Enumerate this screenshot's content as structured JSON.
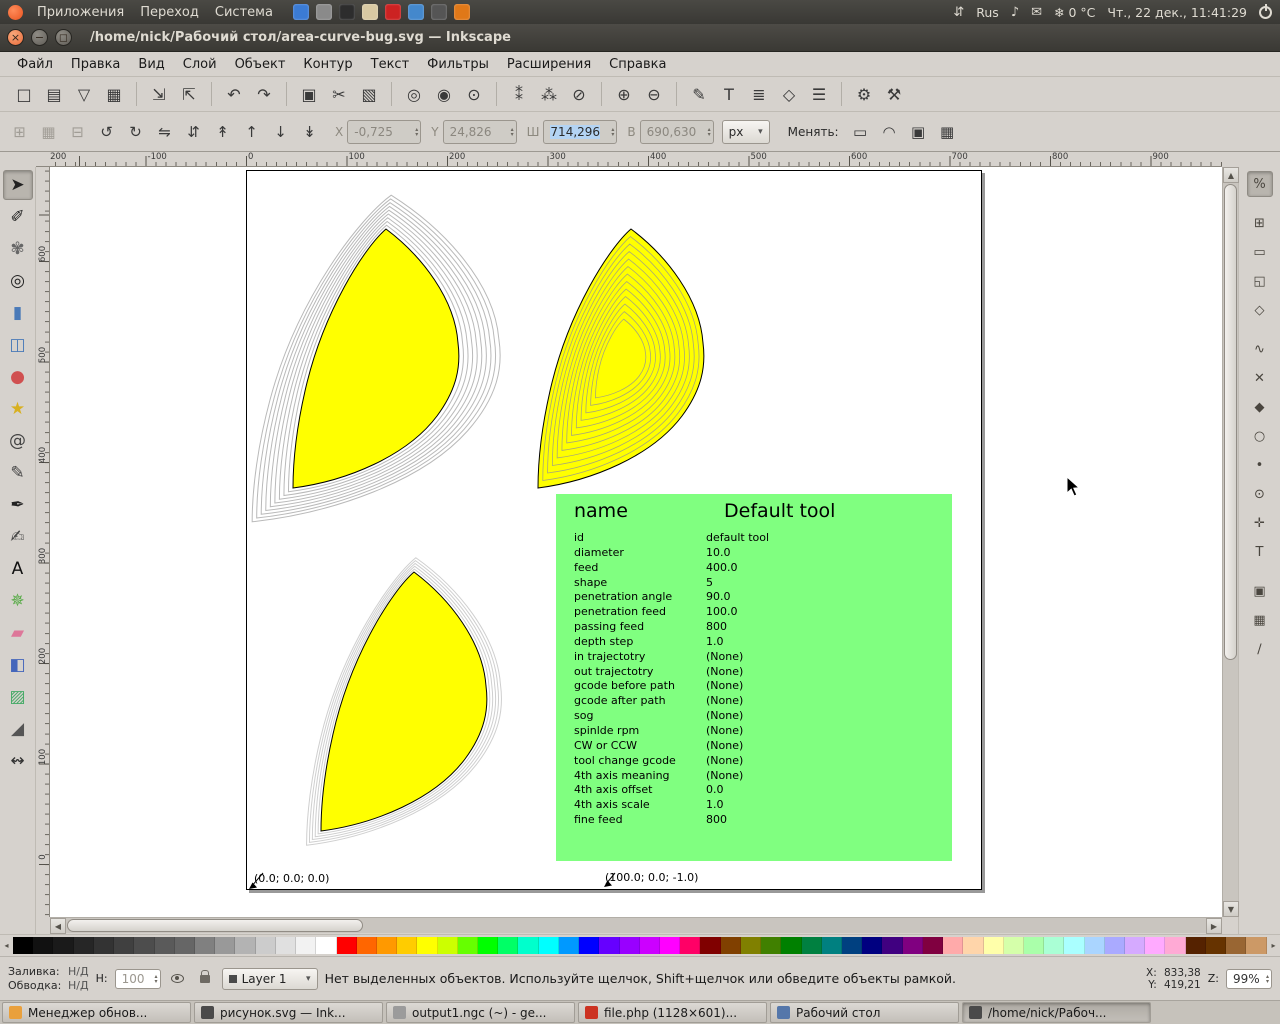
{
  "colors": {
    "panel_bg": "#3b3a36",
    "panel_fg": "#dfdbd2",
    "chrome_bg": "#d6d2cd",
    "chrome_border": "#a9a49d",
    "canvas_bg": "#ffffff",
    "page_border": "#000000",
    "shape_fill": "#ffff00",
    "shape_stroke": "#000000",
    "outer_contour": "#b9b9b9",
    "inner_contour": "#a8a878",
    "infobox_bg": "#80ff80",
    "close_btn": "#e96b3a",
    "selection_bg": "#b3d3f3",
    "taskbar_bg": "#c6c2bb"
  },
  "desktop": {
    "panel_menus": [
      "Приложения",
      "Переход",
      "Система"
    ],
    "launcher_icons": [
      {
        "name": "firefox",
        "color": "#3b7bd4"
      },
      {
        "name": "evolution-mail",
        "color": "#8a8a8a"
      },
      {
        "name": "terminal",
        "color": "#2d2d2d"
      },
      {
        "name": "screenshot-tool",
        "color": "#d8c9a3"
      },
      {
        "name": "openoffice",
        "color": "#cc2222"
      },
      {
        "name": "bluefish",
        "color": "#4488cc"
      },
      {
        "name": "inkscape-launcher",
        "color": "#555555"
      },
      {
        "name": "rhythmbox",
        "color": "#e07818"
      }
    ],
    "tray_icons": {
      "network": "⇵",
      "volume": "♪",
      "mail": "✉",
      "weather": "❄"
    },
    "tray": {
      "keyboard_layout": "Rus",
      "temperature": "0 °C",
      "clock": "Чт., 22 дек., 11:41:29"
    }
  },
  "window": {
    "title": "/home/nick/Рабочий стол/area-curve-bug.svg — Inkscape",
    "close_glyph": "×",
    "minimize_glyph": "−",
    "maximize_glyph": "◻"
  },
  "menubar": [
    "Файл",
    "Правка",
    "Вид",
    "Слой",
    "Объект",
    "Контур",
    "Текст",
    "Фильтры",
    "Расширения",
    "Справка"
  ],
  "commands_toolbar": [
    {
      "name": "new-document",
      "glyph": "□"
    },
    {
      "name": "open-document",
      "glyph": "▤"
    },
    {
      "name": "save-document",
      "glyph": "▽"
    },
    {
      "name": "print-document",
      "glyph": "▦"
    },
    {
      "sep": true
    },
    {
      "name": "import",
      "glyph": "⇲"
    },
    {
      "name": "export",
      "glyph": "⇱"
    },
    {
      "sep": true
    },
    {
      "name": "undo",
      "glyph": "↶"
    },
    {
      "name": "redo",
      "glyph": "↷"
    },
    {
      "sep": true
    },
    {
      "name": "copy",
      "glyph": "▣"
    },
    {
      "name": "cut",
      "glyph": "✂"
    },
    {
      "name": "paste",
      "glyph": "▧"
    },
    {
      "sep": true
    },
    {
      "name": "zoom-to-selection",
      "glyph": "◎"
    },
    {
      "name": "zoom-to-drawing",
      "glyph": "◉"
    },
    {
      "name": "zoom-to-page",
      "glyph": "⊙"
    },
    {
      "sep": true
    },
    {
      "name": "duplicate",
      "glyph": "⁑"
    },
    {
      "name": "create-clone",
      "glyph": "⁂"
    },
    {
      "name": "unlink-clone",
      "glyph": "⊘"
    },
    {
      "sep": true
    },
    {
      "name": "group",
      "glyph": "⊕"
    },
    {
      "name": "ungroup",
      "glyph": "⊖"
    },
    {
      "sep": true
    },
    {
      "name": "fill-stroke-dialog",
      "glyph": "✎"
    },
    {
      "name": "text-dialog",
      "glyph": "T"
    },
    {
      "name": "layers-dialog",
      "glyph": "≣"
    },
    {
      "name": "xml-editor",
      "glyph": "◇"
    },
    {
      "name": "align-dialog",
      "glyph": "☰"
    },
    {
      "sep": true
    },
    {
      "name": "preferences",
      "glyph": "⚙"
    },
    {
      "name": "document-properties",
      "glyph": "⚒"
    }
  ],
  "tool_options": {
    "buttons_left": [
      {
        "name": "select-all",
        "glyph": "⊞",
        "disabled": true
      },
      {
        "name": "select-all-layers",
        "glyph": "▦",
        "disabled": true
      },
      {
        "name": "deselect",
        "glyph": "⊟",
        "disabled": true
      },
      {
        "name": "rotate-ccw",
        "glyph": "↺"
      },
      {
        "name": "rotate-cw",
        "glyph": "↻"
      },
      {
        "name": "flip-horizontal",
        "glyph": "⇋"
      },
      {
        "name": "flip-vertical",
        "glyph": "⇵"
      },
      {
        "name": "raise-to-top",
        "glyph": "↟"
      },
      {
        "name": "raise",
        "glyph": "↑"
      },
      {
        "name": "lower",
        "glyph": "↓"
      },
      {
        "name": "lower-to-bottom",
        "glyph": "↡"
      }
    ],
    "fields": [
      {
        "label": "X",
        "value": "-0,725",
        "selected": false
      },
      {
        "label": "Y",
        "value": "24,826",
        "selected": false
      },
      {
        "label": "Ш",
        "value": "714,296",
        "selected": true
      },
      {
        "label": "В",
        "value": "690,630",
        "selected": false
      }
    ],
    "unit": "px",
    "change_label": "Менять:",
    "toggles": [
      {
        "name": "scale-stroke-toggle",
        "glyph": "▭"
      },
      {
        "name": "scale-corners-toggle",
        "glyph": "◠"
      },
      {
        "name": "move-gradients-toggle",
        "glyph": "▣"
      },
      {
        "name": "move-patterns-toggle",
        "glyph": "▦"
      }
    ]
  },
  "rulers": {
    "h_labels": [
      "-200",
      "-100",
      "0",
      "100",
      "200",
      "300",
      "400",
      "500",
      "600",
      "700",
      "800",
      "900"
    ],
    "v_labels": [
      "600",
      "500",
      "400",
      "300",
      "200",
      "100",
      "0"
    ]
  },
  "tools_palette": [
    {
      "name": "selector-tool",
      "glyph": "➤",
      "color": "#222222"
    },
    {
      "name": "node-tool",
      "glyph": "✐",
      "color": "#222222"
    },
    {
      "name": "tweak-tool",
      "glyph": "✾",
      "color": "#666666"
    },
    {
      "name": "zoom-tool",
      "glyph": "◎",
      "color": "#222222"
    },
    {
      "name": "rectangle-tool",
      "glyph": "▮",
      "color": "#4a7ab8"
    },
    {
      "name": "box3d-tool",
      "glyph": "◫",
      "color": "#4a7ab8"
    },
    {
      "name": "ellipse-tool",
      "glyph": "●",
      "color": "#d05050"
    },
    {
      "name": "star-tool",
      "glyph": "★",
      "color": "#d8b020"
    },
    {
      "name": "spiral-tool",
      "glyph": "@",
      "color": "#444444"
    },
    {
      "name": "pencil-tool",
      "glyph": "✎",
      "color": "#444444"
    },
    {
      "name": "pen-tool",
      "glyph": "✒",
      "color": "#222222"
    },
    {
      "name": "calligraphy-tool",
      "glyph": "✍",
      "color": "#444444"
    },
    {
      "name": "text-tool",
      "glyph": "A",
      "color": "#111111"
    },
    {
      "name": "spray-tool",
      "glyph": "✵",
      "color": "#55aa44"
    },
    {
      "name": "eraser-tool",
      "glyph": "▰",
      "color": "#dd7799"
    },
    {
      "name": "paint-bucket-tool",
      "glyph": "◧",
      "color": "#4466bb"
    },
    {
      "name": "gradient-tool",
      "glyph": "▨",
      "color": "#44aa66"
    },
    {
      "name": "dropper-tool",
      "glyph": "◢",
      "color": "#555555"
    },
    {
      "name": "connector-tool",
      "glyph": "↭",
      "color": "#333333"
    }
  ],
  "snap_toolbar": [
    {
      "name": "snap-enable",
      "glyph": "%"
    },
    {
      "name": "snap-bbox",
      "glyph": "⊞"
    },
    {
      "name": "snap-bbox-edges",
      "glyph": "▭"
    },
    {
      "name": "snap-bbox-corners",
      "glyph": "◱"
    },
    {
      "name": "snap-nodes",
      "glyph": "◇"
    },
    {
      "name": "snap-paths",
      "glyph": "∿"
    },
    {
      "name": "snap-path-intersections",
      "glyph": "✕"
    },
    {
      "name": "snap-cusp-nodes",
      "glyph": "◆"
    },
    {
      "name": "snap-smooth-nodes",
      "glyph": "○"
    },
    {
      "name": "snap-midpoints",
      "glyph": "•"
    },
    {
      "name": "snap-object-centers",
      "glyph": "⊙"
    },
    {
      "name": "snap-rotation-centers",
      "glyph": "✛"
    },
    {
      "name": "snap-text-baselines",
      "glyph": "T"
    },
    {
      "name": "snap-page-border",
      "glyph": "▣"
    },
    {
      "name": "snap-grids",
      "glyph": "▦"
    },
    {
      "name": "snap-guides",
      "glyph": "∕"
    }
  ],
  "canvas": {
    "annotations": [
      {
        "text": "(0.0; 0.0; 0.0)"
      },
      {
        "text": "(100.0; 0.0; -1.0)"
      }
    ],
    "tool_table": {
      "name_label": "name",
      "name_value": "Default tool",
      "rows": [
        [
          "id",
          "default tool"
        ],
        [
          "diameter",
          "10.0"
        ],
        [
          "feed",
          "400.0"
        ],
        [
          "shape",
          "5"
        ],
        [
          "penetration angle",
          "90.0"
        ],
        [
          "penetration feed",
          "100.0"
        ],
        [
          "passing feed",
          "800"
        ],
        [
          "depth step",
          "1.0"
        ],
        [
          "in trajectotry",
          "(None)"
        ],
        [
          "out trajectotry",
          "(None)"
        ],
        [
          "gcode before path",
          "(None)"
        ],
        [
          "gcode after path",
          "(None)"
        ],
        [
          "sog",
          "(None)"
        ],
        [
          "spinlde rpm",
          "(None)"
        ],
        [
          "CW or CCW",
          "(None)"
        ],
        [
          "tool change gcode",
          "(None)"
        ],
        [
          "4th axis meaning",
          "(None)"
        ],
        [
          "4th axis offset",
          "0.0"
        ],
        [
          "4th axis scale",
          "1.0"
        ],
        [
          "fine feed",
          "800"
        ]
      ]
    }
  },
  "palette_colors": [
    "#000000",
    "#111111",
    "#1a1a1a",
    "#262626",
    "#333333",
    "#404040",
    "#4d4d4d",
    "#5a5a5a",
    "#666666",
    "#808080",
    "#999999",
    "#b3b3b3",
    "#cccccc",
    "#e0e0e0",
    "#f2f2f2",
    "#ffffff",
    "#ff0000",
    "#ff6600",
    "#ff9900",
    "#ffcc00",
    "#ffff00",
    "#ccff00",
    "#66ff00",
    "#00ff00",
    "#00ff66",
    "#00ffcc",
    "#00ffff",
    "#0099ff",
    "#0000ff",
    "#6600ff",
    "#9900ff",
    "#cc00ff",
    "#ff00ff",
    "#ff0066",
    "#800000",
    "#804000",
    "#808000",
    "#408000",
    "#008000",
    "#008040",
    "#008080",
    "#004080",
    "#000080",
    "#400080",
    "#800080",
    "#800040",
    "#ffaaaa",
    "#ffd5aa",
    "#ffffaa",
    "#d5ffaa",
    "#aaffaa",
    "#aaffd5",
    "#aaffff",
    "#aad5ff",
    "#aaaaff",
    "#d5aaff",
    "#ffaaff",
    "#ffaad5",
    "#552200",
    "#663300",
    "#996633",
    "#cc9966"
  ],
  "statusbar": {
    "fill_label": "Заливка:",
    "fill_value": "Н/Д",
    "stroke_label": "Обводка:",
    "stroke_value": "Н/Д",
    "opacity_label": "Н:",
    "opacity_value": "100",
    "layer_name": "Layer 1",
    "message": "Нет выделенных объектов. Используйте щелчок, Shift+щелчок или обведите объекты рамкой.",
    "x_label": "X:",
    "x_value": "833,38",
    "y_label": "Y:",
    "y_value": "419,21",
    "zoom_label": "Z:",
    "zoom_value": "99%"
  },
  "taskbar": [
    {
      "title": "Менеджер обнов...",
      "icon": "update-manager",
      "icon_color": "#e9a03c",
      "active": false
    },
    {
      "title": "рисунок.svg — Ink...",
      "icon": "inkscape",
      "icon_color": "#4a4a4a",
      "active": false
    },
    {
      "title": "output1.ngc (~) - ge...",
      "icon": "gedit",
      "icon_color": "#9b9b9b",
      "active": false
    },
    {
      "title": "file.php (1128×601)...",
      "icon": "image-viewer",
      "icon_color": "#cc3322",
      "active": false
    },
    {
      "title": "Рабочий стол",
      "icon": "desktop",
      "icon_color": "#5577aa",
      "active": false
    },
    {
      "title": "/home/nick/Рабоч...",
      "icon": "inkscape",
      "icon_color": "#4a4a4a",
      "active": true
    }
  ]
}
